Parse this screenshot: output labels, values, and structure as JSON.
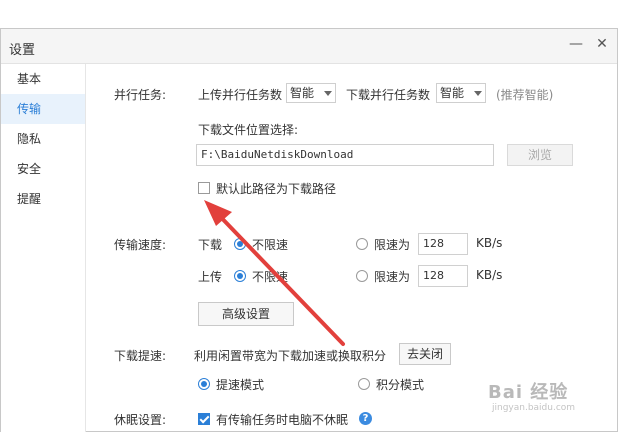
{
  "window": {
    "title": "设置",
    "minimize_label": "—",
    "close_label": "✕"
  },
  "sidebar": {
    "items": [
      {
        "label": "基本"
      },
      {
        "label": "传输"
      },
      {
        "label": "隐私"
      },
      {
        "label": "安全"
      },
      {
        "label": "提醒"
      }
    ],
    "active_index": 1
  },
  "parallel": {
    "label": "并行任务:",
    "upload_label": "上传并行任务数",
    "upload_value": "智能",
    "download_label": "下载并行任务数",
    "download_value": "智能",
    "hint": "(推荐智能)"
  },
  "location": {
    "label": "下载文件位置选择:",
    "path": "F:\\BaiduNetdiskDownload",
    "browse_label": "浏览",
    "default_checkbox_label": "默认此路径为下载路径",
    "default_checked": false
  },
  "speed": {
    "label": "传输速度:",
    "download_label": "下载",
    "upload_label": "上传",
    "unlimited_label": "不限速",
    "limit_label": "限速为",
    "download_limit_value": "128",
    "upload_limit_value": "128",
    "unit": "KB/s",
    "download_mode": "unlimited",
    "upload_mode": "unlimited",
    "advanced_label": "高级设置"
  },
  "boost": {
    "label": "下载提速:",
    "description": "利用闲置带宽为下载加速或换取积分",
    "close_button_label": "去关闭",
    "mode_speed_label": "提速模式",
    "mode_points_label": "积分模式",
    "selected_mode": "speed"
  },
  "sleep": {
    "label": "休眠设置:",
    "checkbox_label": "有传输任务时电脑不休眠",
    "checked": true,
    "help_label": "?"
  },
  "watermark": {
    "text": "Bai 经验",
    "sub": "jingyan.baidu.com"
  },
  "colors": {
    "accent": "#2b7fd7",
    "arrow": "#e2403c",
    "active_bg": "#e8f2fc"
  }
}
